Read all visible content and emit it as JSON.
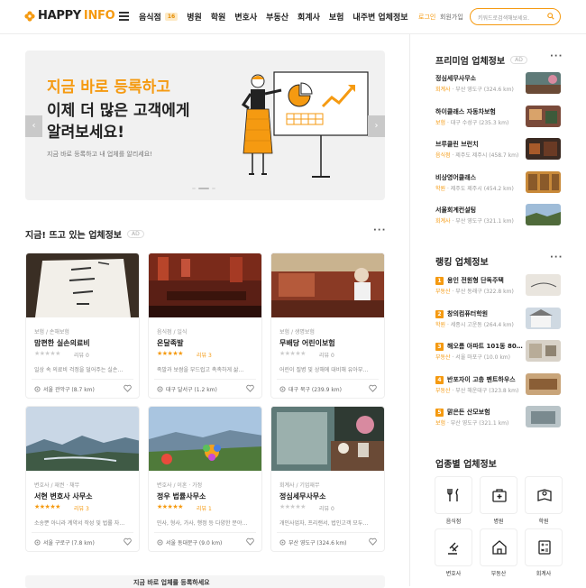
{
  "header": {
    "logo_happy": "HAPPY",
    "logo_info": "INFO",
    "nav": [
      {
        "label": "음식점",
        "badge": "16"
      },
      {
        "label": "병원"
      },
      {
        "label": "학원"
      },
      {
        "label": "변호사"
      },
      {
        "label": "부동산"
      },
      {
        "label": "회계사"
      },
      {
        "label": "보험"
      },
      {
        "label": "내주변 업체정보"
      }
    ],
    "login": "로그인",
    "join": "회원가입",
    "search_placeholder": "키워드로검색해보세요."
  },
  "banner": {
    "line1": "지금 바로 등록하고",
    "line2": "이제 더 많은 고객에게",
    "line3": "알려보세요!",
    "sub": "지금 바로 등록하고 내 업체를 알리세요!",
    "prev": "‹",
    "next": "›"
  },
  "hot": {
    "title": "지금! 뜨고 있는 업체정보",
    "ad": "AD",
    "cards": [
      {
        "cat": "보험 / 손해보험",
        "name": "맘편한 실손의료비",
        "stars": 0,
        "reviews": "리뷰 0",
        "desc": "일상 속 의료비 걱정을 덜어주는 실손…",
        "loc": "서울 관악구 (8.7 km)"
      },
      {
        "cat": "음식점 / 일식",
        "name": "온달족발",
        "stars": 5,
        "reviews": "리뷰 3",
        "desc": "족발과 보쌈을 부드럽고 촉촉하게 삶…",
        "loc": "대구 달서구 (1.2 km)"
      },
      {
        "cat": "보험 / 생명보험",
        "name": "무배당 어린이보험",
        "stars": 0,
        "reviews": "리뷰 0",
        "desc": "어린이 질병 및 상해에 대비해 유아부…",
        "loc": "대구 북구 (239.9 km)"
      },
      {
        "cat": "변호사 / 재권 · 채무",
        "name": "서현 변호사 사무소",
        "stars": 5,
        "reviews": "리뷰 3",
        "desc": "소송뿐 아니라 계약서 작성 및 법률 자…",
        "loc": "서울 구로구 (7.8 km)"
      },
      {
        "cat": "변호사 / 이혼 · 가정",
        "name": "정우 법률사무소",
        "stars": 5,
        "reviews": "리뷰 1",
        "desc": "민사, 형사, 가사, 행정 등 다양한 분야…",
        "loc": "서울 동대문구 (9.0 km)"
      },
      {
        "cat": "회계사 / 기업재무",
        "name": "정심세무사무소",
        "stars": 0,
        "reviews": "리뷰 0",
        "desc": "개인사업자, 프리랜서, 법인고객 모두…",
        "loc": "부산 영도구 (324.6 km)"
      }
    ]
  },
  "premium": {
    "title": "프리미엄 업체정보",
    "ad": "AD",
    "items": [
      {
        "name": "정심세무사무소",
        "cat": "회계사",
        "loc": "부산 영도구 (324.6 km)"
      },
      {
        "name": "하이클래스 자동차보험",
        "cat": "보험",
        "loc": "대구 수성구 (235.3 km)"
      },
      {
        "name": "브루클린 브런치",
        "cat": "음식점",
        "loc": "제주도 제주시 (458.7 km)"
      },
      {
        "name": "비상영어클래스",
        "cat": "학원",
        "loc": "제주도 제주시 (454.2 km)"
      },
      {
        "name": "서울회계컨설팅",
        "cat": "회계사",
        "loc": "부산 영도구 (321.1 km)"
      }
    ]
  },
  "ranking": {
    "title": "랭킹 업체정보",
    "items": [
      {
        "rank": "1",
        "name": "용인 전원형 단독주택",
        "cat": "부동산",
        "loc": "부산 동래구 (322.8 km)"
      },
      {
        "rank": "2",
        "name": "창의컴퓨터학원",
        "cat": "학원",
        "loc": "세종시 고운동 (264.4 km)"
      },
      {
        "rank": "3",
        "name": "해오름 아파트 101동 80…",
        "cat": "부동산",
        "loc": "서울 마포구 (10.0 km)"
      },
      {
        "rank": "4",
        "name": "반포자이 고층 펜트하우스",
        "cat": "부동산",
        "loc": "부산 해운대구 (323.8 km)"
      },
      {
        "rank": "5",
        "name": "맑은든 산모보험",
        "cat": "보험",
        "loc": "부산 영도구 (321.1 km)"
      }
    ]
  },
  "categories": {
    "title": "업종별 업체정보",
    "items": [
      "음식점",
      "병원",
      "학원",
      "변호사",
      "부동산",
      "회계사"
    ]
  },
  "bottom": {
    "text": "지금 바로 업체를 등록하세요"
  },
  "colors": {
    "accent": "#f59a11"
  }
}
